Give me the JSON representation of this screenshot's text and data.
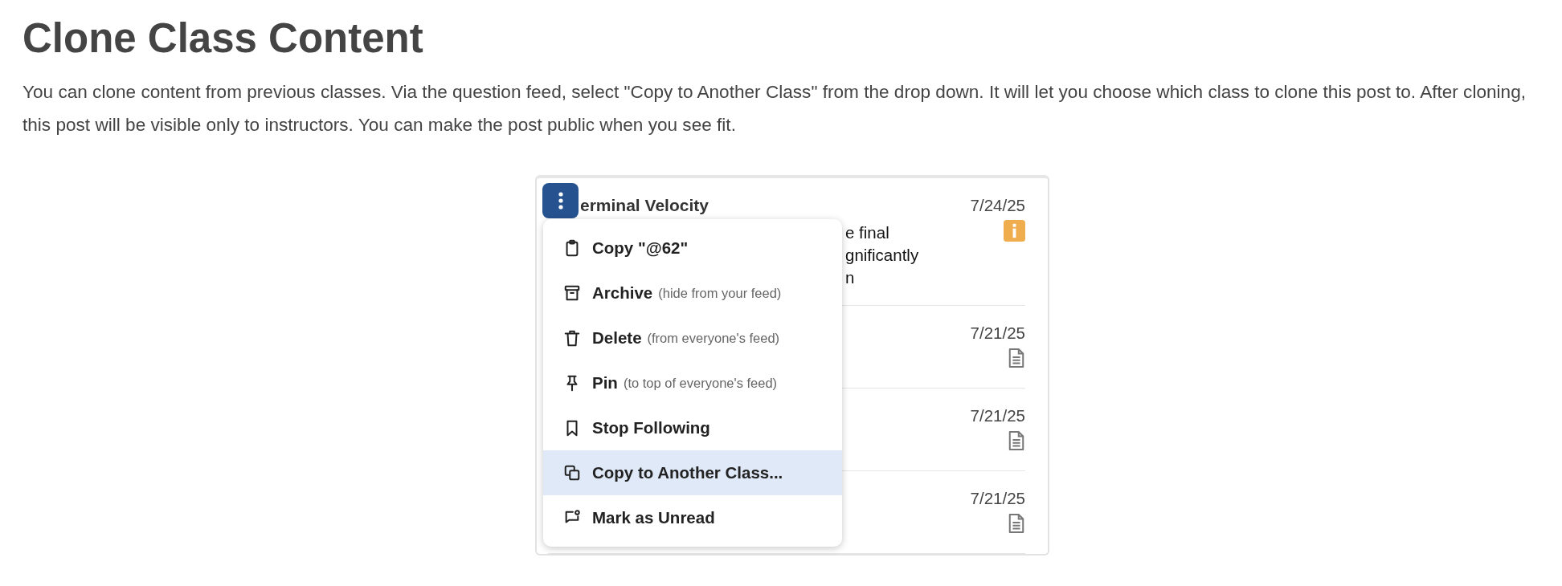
{
  "heading": "Clone Class Content",
  "description": "You can clone content from previous classes. Via the question feed, select \"Copy to Another Class\" from the drop down. It will let you choose which class to clone this post to. After cloning, this post will be visible only to instructors. You can make the post public when you see fit.",
  "feed": {
    "posts": [
      {
        "title": "erminal Velocity",
        "preview_lines": [
          "e final",
          "gnificantly",
          "n"
        ],
        "date": "7/24/25",
        "kind": "info"
      },
      {
        "date": "7/21/25",
        "kind": "note"
      },
      {
        "date": "7/21/25",
        "kind": "note"
      },
      {
        "date": "7/21/25",
        "kind": "note"
      }
    ]
  },
  "menu": {
    "items": [
      {
        "kind": "clipboard",
        "label": "Copy \"@62\"",
        "selected": false
      },
      {
        "kind": "archive",
        "label": "Archive",
        "note": "(hide from your feed)",
        "selected": false
      },
      {
        "kind": "trash",
        "label": "Delete",
        "note": "(from everyone's feed)",
        "selected": false
      },
      {
        "kind": "pin",
        "label": "Pin",
        "note": "(to top of everyone's feed)",
        "selected": false
      },
      {
        "kind": "bookmark",
        "label": "Stop Following",
        "selected": false
      },
      {
        "kind": "copy",
        "label": "Copy to Another Class...",
        "selected": true
      },
      {
        "kind": "unread",
        "label": "Mark as Unread",
        "selected": false
      }
    ]
  }
}
